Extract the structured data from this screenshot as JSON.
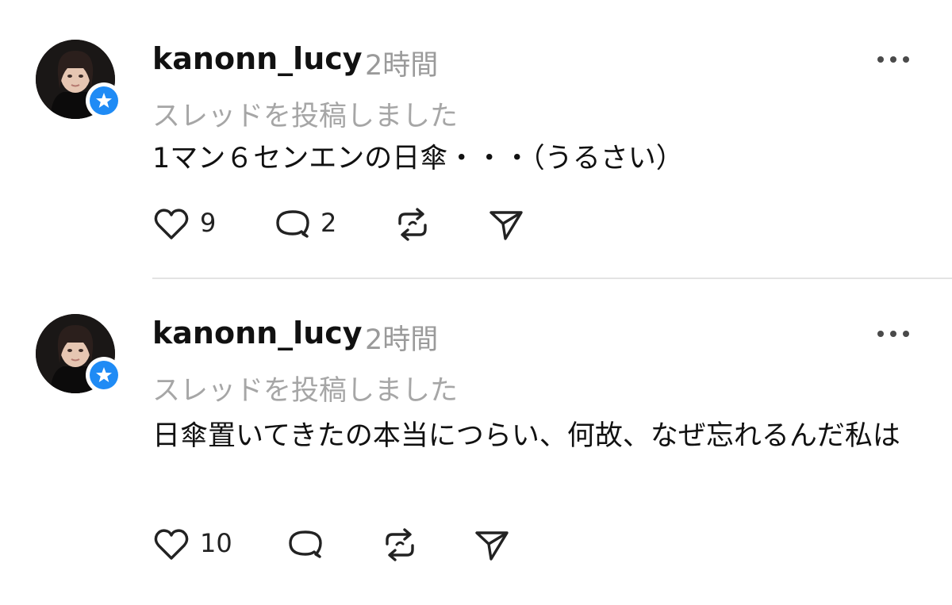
{
  "posts": [
    {
      "username": "kanonn_lucy",
      "time": "2時間",
      "status": "スレッドを投稿しました",
      "text": "1マン６センエンの日傘・・・（うるさい）",
      "likes": "9",
      "replies": "2"
    },
    {
      "username": "kanonn_lucy",
      "time": "2時間",
      "status": "スレッドを投稿しました",
      "text": "日傘置いてきたの本当につらい、何故、なぜ忘れるんだ私は",
      "likes": "10",
      "replies": ""
    }
  ],
  "colors": {
    "verified_badge": "#1f8bf5",
    "muted_text": "#9a9a9a",
    "divider": "#e3e3e3"
  },
  "icons": [
    "heart-icon",
    "reply-icon",
    "repost-icon",
    "share-icon",
    "more-icon",
    "verified-star-icon"
  ]
}
